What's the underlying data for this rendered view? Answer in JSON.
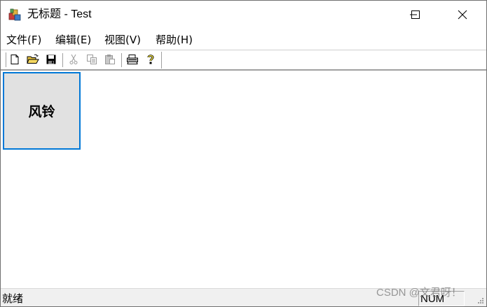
{
  "window": {
    "title": "无标题 - Test",
    "controls": [
      "minimize",
      "maximize",
      "close"
    ]
  },
  "menu": {
    "items": [
      {
        "label": "文件(F)"
      },
      {
        "label": "编辑(E)"
      },
      {
        "label": "视图(V)"
      },
      {
        "label": "帮助(H)"
      }
    ]
  },
  "toolbar": {
    "buttons": [
      {
        "icon": "new-file-icon",
        "enabled": true
      },
      {
        "icon": "open-folder-icon",
        "enabled": true
      },
      {
        "icon": "save-icon",
        "enabled": true
      },
      {
        "icon": "cut-icon",
        "enabled": false
      },
      {
        "icon": "copy-icon",
        "enabled": false
      },
      {
        "icon": "paste-icon",
        "enabled": false
      },
      {
        "icon": "print-icon",
        "enabled": true
      },
      {
        "icon": "help-icon",
        "enabled": true
      }
    ]
  },
  "client": {
    "button_label": "风铃"
  },
  "status": {
    "text": "就绪",
    "num_indicator": "NUM"
  },
  "watermark": "CSDN @文君呀！",
  "colors": {
    "focus_border": "#0078d7",
    "button_face": "#e1e1e1",
    "statusbar_bg": "#f0f0f0"
  }
}
